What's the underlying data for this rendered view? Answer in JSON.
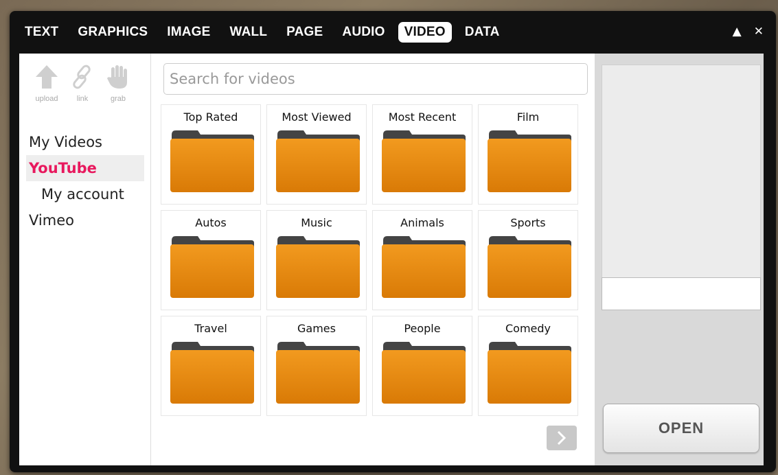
{
  "tabs": [
    "TEXT",
    "GRAPHICS",
    "IMAGE",
    "WALL",
    "PAGE",
    "AUDIO",
    "VIDEO",
    "DATA"
  ],
  "active_tab": "VIDEO",
  "window_controls": {
    "collapse": "▲",
    "close": "✕"
  },
  "tools": [
    {
      "label": "upload",
      "icon": "upload-arrow-icon"
    },
    {
      "label": "link",
      "icon": "link-icon"
    },
    {
      "label": "grab",
      "icon": "hand-grab-icon"
    }
  ],
  "nav": [
    {
      "label": "My Videos",
      "active": false,
      "sub": false
    },
    {
      "label": "YouTube",
      "active": true,
      "sub": false
    },
    {
      "label": "My account",
      "active": false,
      "sub": true
    },
    {
      "label": "Vimeo",
      "active": false,
      "sub": false
    }
  ],
  "search": {
    "placeholder": "Search for videos",
    "value": ""
  },
  "categories": [
    "Top Rated",
    "Most Viewed",
    "Most Recent",
    "Film",
    "Autos",
    "Music",
    "Animals",
    "Sports",
    "Travel",
    "Games",
    "People",
    "Comedy"
  ],
  "next_icon": "chevron-right-icon",
  "open_label": "OPEN",
  "colors": {
    "accent": "#e8195e",
    "folder": "#e88a10",
    "folder_tab": "#4a4a4a"
  }
}
